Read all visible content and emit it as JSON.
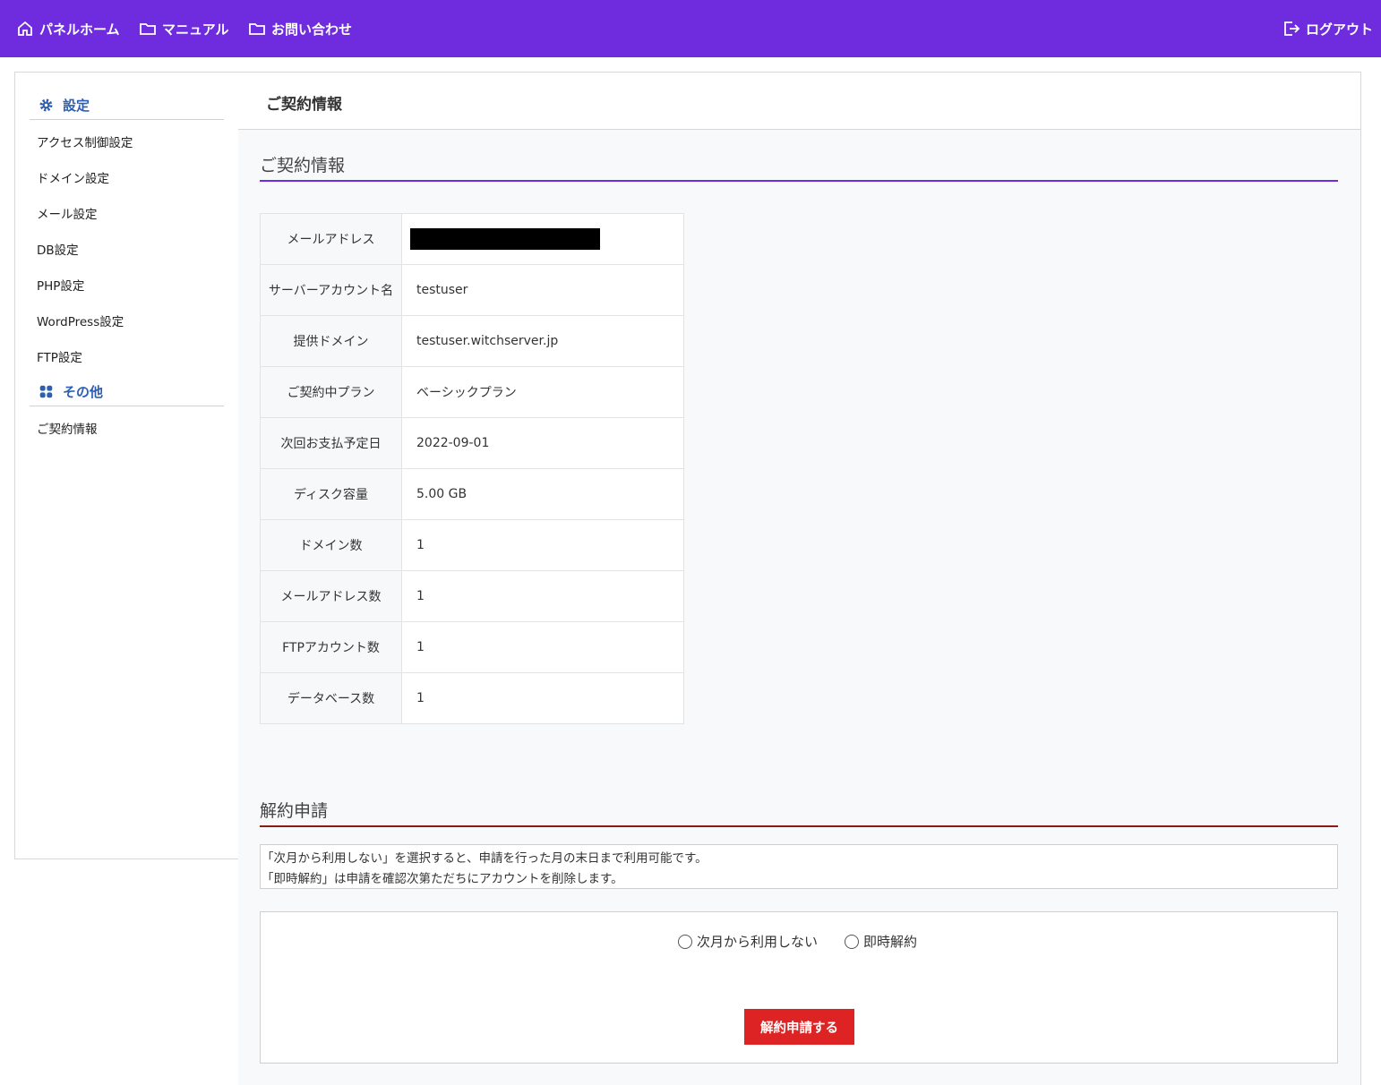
{
  "nav": {
    "home": "パネルホーム",
    "manual": "マニュアル",
    "contact": "お問い合わせ",
    "logout": "ログアウト"
  },
  "sidebar": {
    "settings_heading": "設定",
    "settings_items": [
      "アクセス制御設定",
      "ドメイン設定",
      "メール設定",
      "DB設定",
      "PHP設定",
      "WordPress設定",
      "FTP設定"
    ],
    "other_heading": "その他",
    "other_items": [
      "ご契約情報"
    ]
  },
  "page": {
    "header_title": "ご契約情報",
    "contract_section_title": "ご契約情報",
    "cancel_section_title": "解約申請"
  },
  "contract_table": [
    {
      "label": "メールアドレス",
      "value": ""
    },
    {
      "label": "サーバーアカウント名",
      "value": "testuser"
    },
    {
      "label": "提供ドメイン",
      "value": "testuser.witchserver.jp"
    },
    {
      "label": "ご契約中プラン",
      "value": "ベーシックプラン"
    },
    {
      "label": "次回お支払予定日",
      "value": "2022-09-01"
    },
    {
      "label": "ディスク容量",
      "value": "5.00 GB"
    },
    {
      "label": "ドメイン数",
      "value": "1"
    },
    {
      "label": "メールアドレス数",
      "value": "1"
    },
    {
      "label": "FTPアカウント数",
      "value": "1"
    },
    {
      "label": "データベース数",
      "value": "1"
    }
  ],
  "notice": {
    "line1": "「次月から利用しない」を選択すると、申請を行った月の末日まで利用可能です。",
    "line2": "「即時解約」は申請を確認次第ただちにアカウントを削除します。"
  },
  "cancel_form": {
    "option_next_month": "次月から利用しない",
    "option_immediate": "即時解約",
    "submit_label": "解約申請する"
  },
  "colors": {
    "topbar": "#6f2cde",
    "sidebar_heading": "#2c5fb3",
    "cancel_button": "#dd2323",
    "cancel_underline": "#8b1b1b"
  }
}
